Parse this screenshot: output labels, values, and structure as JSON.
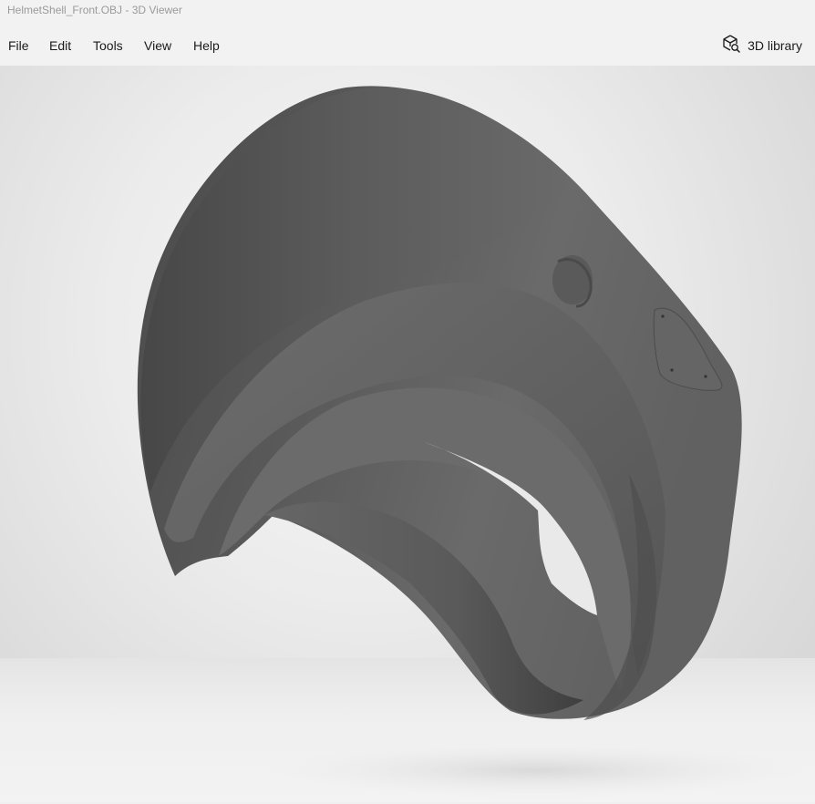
{
  "window": {
    "title": "HelmetShell_Front.OBJ - 3D Viewer"
  },
  "menu": {
    "items": [
      {
        "label": "File"
      },
      {
        "label": "Edit"
      },
      {
        "label": "Tools"
      },
      {
        "label": "View"
      },
      {
        "label": "Help"
      }
    ]
  },
  "toolbar": {
    "library_label": "3D library",
    "library_icon": "3d-cube-search-icon"
  },
  "viewport": {
    "model_name": "HelmetShell_Front.OBJ",
    "model_color": "#5f5f5f",
    "background_color": "#e6e6e6"
  }
}
